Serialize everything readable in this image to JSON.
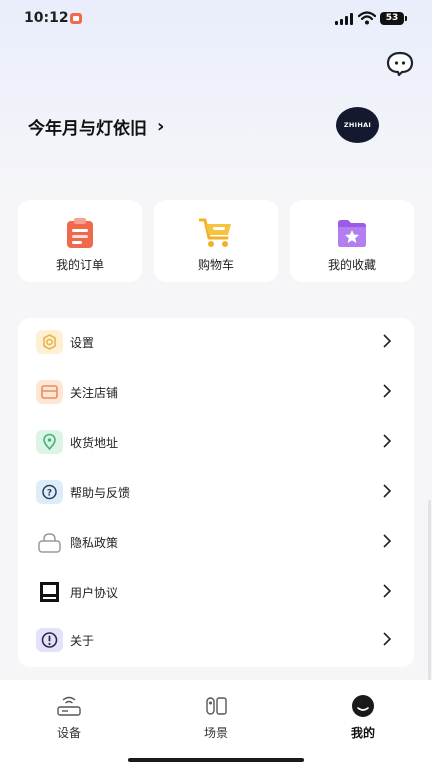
{
  "status_bar": {
    "time": "10:12",
    "battery": "53"
  },
  "profile": {
    "username": "今年月与灯依旧",
    "avatar_text": "ZHIHAI"
  },
  "quick_actions": [
    {
      "label": "我的订单",
      "icon": "clipboard-icon"
    },
    {
      "label": "购物车",
      "icon": "shopping-cart-icon"
    },
    {
      "label": "我的收藏",
      "icon": "star-folder-icon"
    }
  ],
  "menu": [
    {
      "label": "设置",
      "icon": "gear-icon"
    },
    {
      "label": "关注店铺",
      "icon": "store-icon"
    },
    {
      "label": "收货地址",
      "icon": "location-pin-icon"
    },
    {
      "label": "帮助与反馈",
      "icon": "question-icon"
    },
    {
      "label": "隐私政策",
      "icon": "lock-icon"
    },
    {
      "label": "用户协议",
      "icon": "book-icon"
    },
    {
      "label": "关于",
      "icon": "info-icon"
    }
  ],
  "tabbar": [
    {
      "label": "设备",
      "icon": "router-icon",
      "active": false
    },
    {
      "label": "场景",
      "icon": "scene-icon",
      "active": false
    },
    {
      "label": "我的",
      "icon": "profile-face-icon",
      "active": true
    }
  ],
  "colors": {
    "background": "#f6f6f8",
    "card": "#ffffff",
    "avatar_bg": "#14192f"
  }
}
